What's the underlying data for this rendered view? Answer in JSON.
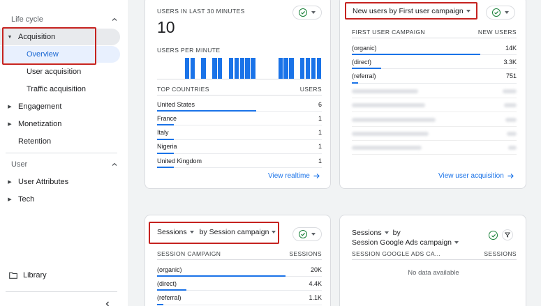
{
  "sidebar": {
    "lifecycle_header": "Life cycle",
    "items": {
      "acquisition": "Acquisition",
      "overview": "Overview",
      "user_acquisition": "User acquisition",
      "traffic_acquisition": "Traffic acquisition",
      "engagement": "Engagement",
      "monetization": "Monetization",
      "retention": "Retention"
    },
    "user_header": "User",
    "user_items": {
      "user_attributes": "User Attributes",
      "tech": "Tech"
    },
    "library": "Library"
  },
  "realtime_card": {
    "title": "USERS IN LAST 30 MINUTES",
    "count": "10",
    "per_minute_label": "USERS PER MINUTE",
    "per_minute_bars": [
      0,
      0,
      0,
      0,
      0,
      1,
      1,
      0,
      1,
      0,
      1,
      1,
      0,
      1,
      1,
      1,
      1,
      1,
      0,
      0,
      0,
      0,
      1,
      1,
      1,
      0,
      1,
      1,
      1,
      1
    ],
    "col_country": "TOP COUNTRIES",
    "col_users": "USERS",
    "rows": [
      {
        "name": "United States",
        "value": "6",
        "frac": 0.6
      },
      {
        "name": "France",
        "value": "1",
        "frac": 0.1
      },
      {
        "name": "Italy",
        "value": "1",
        "frac": 0.1
      },
      {
        "name": "Nigeria",
        "value": "1",
        "frac": 0.1
      },
      {
        "name": "United Kingdom",
        "value": "1",
        "frac": 0.1
      }
    ],
    "link": "View realtime"
  },
  "new_users_card": {
    "title": "New users by First user campaign",
    "col_campaign": "FIRST USER CAMPAIGN",
    "col_new_users": "NEW USERS",
    "rows": [
      {
        "name": "(organic)",
        "value": "14K",
        "frac": 0.78
      },
      {
        "name": "(direct)",
        "value": "3.3K",
        "frac": 0.18
      },
      {
        "name": "(referral)",
        "value": "751",
        "frac": 0.04
      }
    ],
    "link": "View user acquisition"
  },
  "sessions_card": {
    "title_metric": "Sessions",
    "title_by": "by Session campaign",
    "col_campaign": "SESSION CAMPAIGN",
    "col_sessions": "SESSIONS",
    "rows": [
      {
        "name": "(organic)",
        "value": "20K",
        "frac": 0.78
      },
      {
        "name": "(direct)",
        "value": "4.4K",
        "frac": 0.18
      },
      {
        "name": "(referral)",
        "value": "1.1K",
        "frac": 0.04
      }
    ]
  },
  "google_ads_card": {
    "title_metric": "Sessions",
    "title_by": "by",
    "title_dim": "Session Google Ads campaign",
    "col_campaign": "SESSION GOOGLE ADS CA...",
    "col_sessions": "SESSIONS",
    "empty": "No data available"
  },
  "colors": {
    "accent": "#1a73e8",
    "highlight": "#c5221f",
    "check": "#188038"
  }
}
